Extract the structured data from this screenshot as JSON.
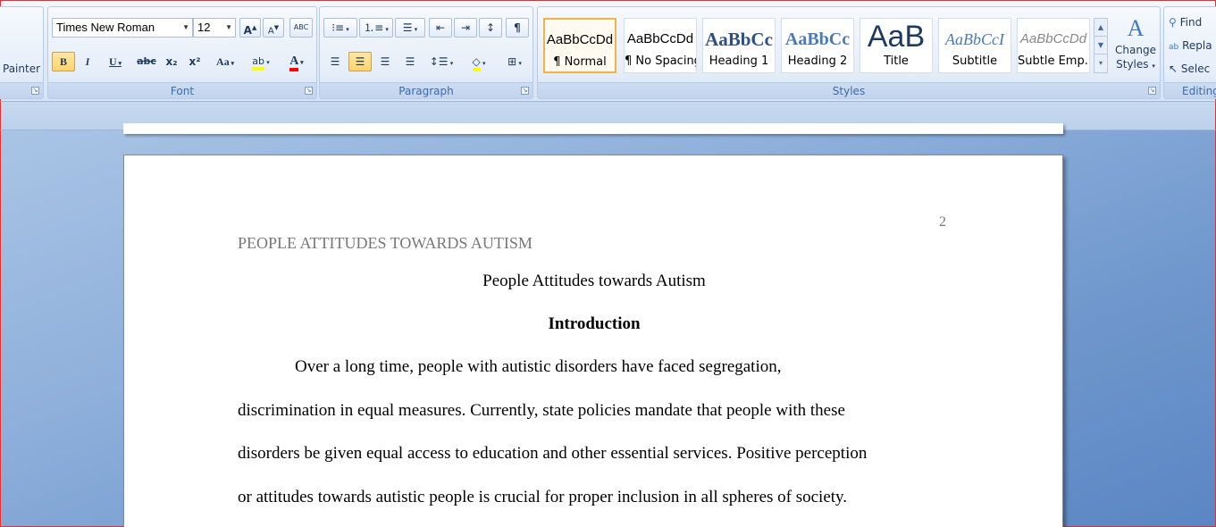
{
  "clipboard": {
    "painter_label": "Painter"
  },
  "font": {
    "group_label": "Font",
    "name": "Times New Roman",
    "size": "12",
    "grow_label": "A",
    "shrink_label": "A",
    "clear_label": "ABC",
    "bold": "B",
    "italic": "I",
    "underline": "U",
    "strike": "abc",
    "subscript": "x₂",
    "superscript": "x²",
    "change_case": "Aa",
    "highlight": "ab",
    "font_color": "A",
    "highlight_color": "#ffff00",
    "font_color_value": "#ff0000"
  },
  "paragraph": {
    "group_label": "Paragraph",
    "show_marks": "¶"
  },
  "styles": {
    "group_label": "Styles",
    "tiles": [
      {
        "sample": "AaBbCcDd",
        "name": "¶ Normal"
      },
      {
        "sample": "AaBbCcDd",
        "name": "¶ No Spacing"
      },
      {
        "sample": "AaBbCc",
        "name": "Heading 1"
      },
      {
        "sample": "AaBbCc",
        "name": "Heading 2"
      },
      {
        "sample": "AaB",
        "name": "Title"
      },
      {
        "sample": "AaBbCcI",
        "name": "Subtitle"
      },
      {
        "sample": "AaBbCcDd",
        "name": "Subtle Emp..."
      }
    ],
    "change_styles_line1": "Change",
    "change_styles_line2": "Styles"
  },
  "editing": {
    "group_label": "Editing",
    "find": "Find",
    "replace": "Repla",
    "select": "Selec"
  },
  "document": {
    "page_number": "2",
    "running_head": "PEOPLE ATTITUDES TOWARDS AUTISM",
    "title": "People Attitudes towards Autism",
    "heading": "Introduction",
    "lines": [
      "Over a long time, people with autistic disorders have faced segregation,",
      "discrimination in equal measures.  Currently, state policies mandate that people with these",
      "disorders be given equal access to education and other essential services. Positive perception",
      "or attitudes towards autistic people is crucial for proper inclusion in all spheres of society."
    ]
  }
}
